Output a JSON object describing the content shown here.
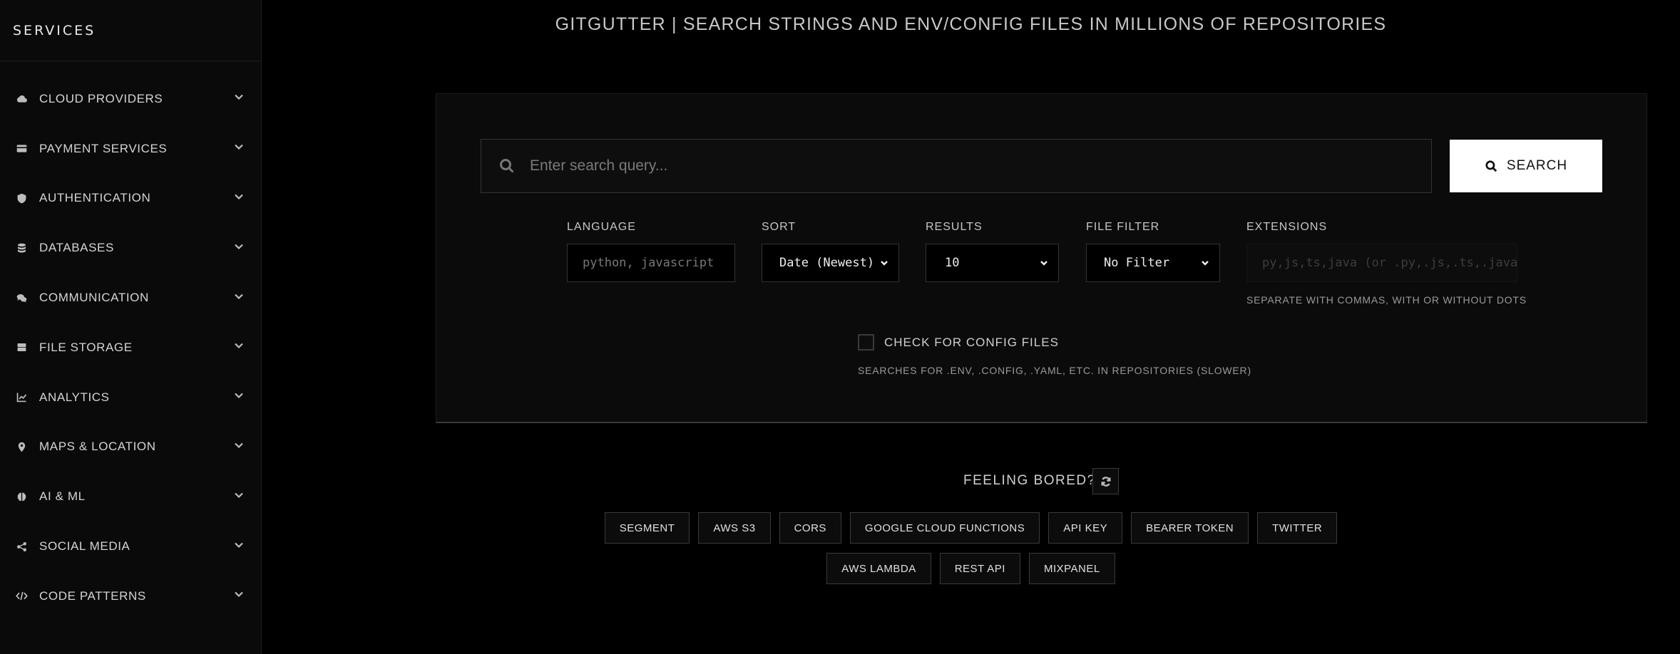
{
  "sidebar": {
    "title": "SERVICES",
    "items": [
      {
        "label": "CLOUD PROVIDERS",
        "icon": "cloud-icon"
      },
      {
        "label": "PAYMENT SERVICES",
        "icon": "credit-card-icon"
      },
      {
        "label": "AUTHENTICATION",
        "icon": "shield-icon"
      },
      {
        "label": "DATABASES",
        "icon": "database-icon"
      },
      {
        "label": "COMMUNICATION",
        "icon": "chat-icon"
      },
      {
        "label": "FILE STORAGE",
        "icon": "hard-drive-icon"
      },
      {
        "label": "ANALYTICS",
        "icon": "line-chart-icon"
      },
      {
        "label": "MAPS & LOCATION",
        "icon": "map-pin-icon"
      },
      {
        "label": "AI & ML",
        "icon": "brain-icon"
      },
      {
        "label": "SOCIAL MEDIA",
        "icon": "share-icon"
      },
      {
        "label": "CODE PATTERNS",
        "icon": "code-icon"
      }
    ]
  },
  "header": {
    "title": "GITGUTTER | SEARCH STRINGS AND ENV/CONFIG FILES IN MILLIONS OF REPOSITORIES"
  },
  "search": {
    "placeholder": "Enter search query...",
    "value": "",
    "button_label": "SEARCH"
  },
  "filters": {
    "language": {
      "label": "LANGUAGE",
      "placeholder": "python, javascript"
    },
    "sort": {
      "label": "SORT",
      "selected": "Date (Newest)"
    },
    "results": {
      "label": "RESULTS",
      "selected": "10"
    },
    "file_filter": {
      "label": "FILE FILTER",
      "selected": "No Filter"
    },
    "extensions": {
      "label": "EXTENSIONS",
      "placeholder": "py,js,ts,java (or .py,.js,.ts,.java",
      "hint": "SEPARATE WITH COMMAS, WITH OR WITHOUT DOTS"
    }
  },
  "config_check": {
    "label": "CHECK FOR CONFIG FILES",
    "checked": false,
    "hint": "SEARCHES FOR .ENV, .CONFIG, .YAML, ETC. IN REPOSITORIES (SLOWER)"
  },
  "bored": {
    "label": "FEELING BORED?",
    "chips_row1": [
      "SEGMENT",
      "AWS S3",
      "CORS",
      "GOOGLE CLOUD FUNCTIONS",
      "API KEY",
      "BEARER TOKEN",
      "TWITTER"
    ],
    "chips_row2": [
      "AWS LAMBDA",
      "REST API",
      "MIXPANEL"
    ]
  }
}
